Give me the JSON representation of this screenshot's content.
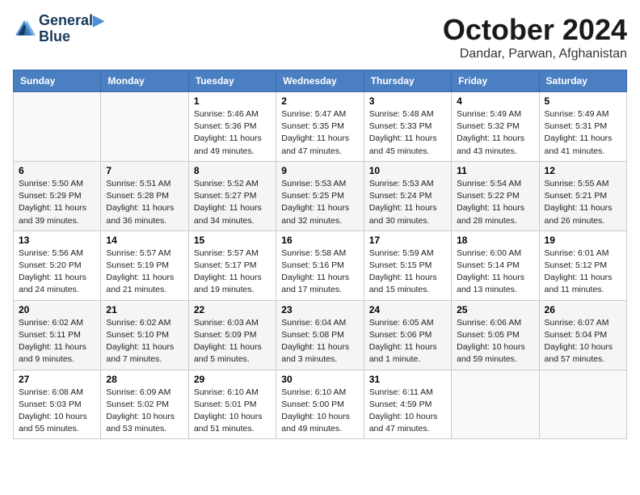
{
  "logo": {
    "line1": "General",
    "line2": "Blue"
  },
  "title": "October 2024",
  "location": "Dandar, Parwan, Afghanistan",
  "headers": [
    "Sunday",
    "Monday",
    "Tuesday",
    "Wednesday",
    "Thursday",
    "Friday",
    "Saturday"
  ],
  "weeks": [
    [
      {
        "day": "",
        "info": ""
      },
      {
        "day": "",
        "info": ""
      },
      {
        "day": "1",
        "info": "Sunrise: 5:46 AM\nSunset: 5:36 PM\nDaylight: 11 hours and 49 minutes."
      },
      {
        "day": "2",
        "info": "Sunrise: 5:47 AM\nSunset: 5:35 PM\nDaylight: 11 hours and 47 minutes."
      },
      {
        "day": "3",
        "info": "Sunrise: 5:48 AM\nSunset: 5:33 PM\nDaylight: 11 hours and 45 minutes."
      },
      {
        "day": "4",
        "info": "Sunrise: 5:49 AM\nSunset: 5:32 PM\nDaylight: 11 hours and 43 minutes."
      },
      {
        "day": "5",
        "info": "Sunrise: 5:49 AM\nSunset: 5:31 PM\nDaylight: 11 hours and 41 minutes."
      }
    ],
    [
      {
        "day": "6",
        "info": "Sunrise: 5:50 AM\nSunset: 5:29 PM\nDaylight: 11 hours and 39 minutes."
      },
      {
        "day": "7",
        "info": "Sunrise: 5:51 AM\nSunset: 5:28 PM\nDaylight: 11 hours and 36 minutes."
      },
      {
        "day": "8",
        "info": "Sunrise: 5:52 AM\nSunset: 5:27 PM\nDaylight: 11 hours and 34 minutes."
      },
      {
        "day": "9",
        "info": "Sunrise: 5:53 AM\nSunset: 5:25 PM\nDaylight: 11 hours and 32 minutes."
      },
      {
        "day": "10",
        "info": "Sunrise: 5:53 AM\nSunset: 5:24 PM\nDaylight: 11 hours and 30 minutes."
      },
      {
        "day": "11",
        "info": "Sunrise: 5:54 AM\nSunset: 5:22 PM\nDaylight: 11 hours and 28 minutes."
      },
      {
        "day": "12",
        "info": "Sunrise: 5:55 AM\nSunset: 5:21 PM\nDaylight: 11 hours and 26 minutes."
      }
    ],
    [
      {
        "day": "13",
        "info": "Sunrise: 5:56 AM\nSunset: 5:20 PM\nDaylight: 11 hours and 24 minutes."
      },
      {
        "day": "14",
        "info": "Sunrise: 5:57 AM\nSunset: 5:19 PM\nDaylight: 11 hours and 21 minutes."
      },
      {
        "day": "15",
        "info": "Sunrise: 5:57 AM\nSunset: 5:17 PM\nDaylight: 11 hours and 19 minutes."
      },
      {
        "day": "16",
        "info": "Sunrise: 5:58 AM\nSunset: 5:16 PM\nDaylight: 11 hours and 17 minutes."
      },
      {
        "day": "17",
        "info": "Sunrise: 5:59 AM\nSunset: 5:15 PM\nDaylight: 11 hours and 15 minutes."
      },
      {
        "day": "18",
        "info": "Sunrise: 6:00 AM\nSunset: 5:14 PM\nDaylight: 11 hours and 13 minutes."
      },
      {
        "day": "19",
        "info": "Sunrise: 6:01 AM\nSunset: 5:12 PM\nDaylight: 11 hours and 11 minutes."
      }
    ],
    [
      {
        "day": "20",
        "info": "Sunrise: 6:02 AM\nSunset: 5:11 PM\nDaylight: 11 hours and 9 minutes."
      },
      {
        "day": "21",
        "info": "Sunrise: 6:02 AM\nSunset: 5:10 PM\nDaylight: 11 hours and 7 minutes."
      },
      {
        "day": "22",
        "info": "Sunrise: 6:03 AM\nSunset: 5:09 PM\nDaylight: 11 hours and 5 minutes."
      },
      {
        "day": "23",
        "info": "Sunrise: 6:04 AM\nSunset: 5:08 PM\nDaylight: 11 hours and 3 minutes."
      },
      {
        "day": "24",
        "info": "Sunrise: 6:05 AM\nSunset: 5:06 PM\nDaylight: 11 hours and 1 minute."
      },
      {
        "day": "25",
        "info": "Sunrise: 6:06 AM\nSunset: 5:05 PM\nDaylight: 10 hours and 59 minutes."
      },
      {
        "day": "26",
        "info": "Sunrise: 6:07 AM\nSunset: 5:04 PM\nDaylight: 10 hours and 57 minutes."
      }
    ],
    [
      {
        "day": "27",
        "info": "Sunrise: 6:08 AM\nSunset: 5:03 PM\nDaylight: 10 hours and 55 minutes."
      },
      {
        "day": "28",
        "info": "Sunrise: 6:09 AM\nSunset: 5:02 PM\nDaylight: 10 hours and 53 minutes."
      },
      {
        "day": "29",
        "info": "Sunrise: 6:10 AM\nSunset: 5:01 PM\nDaylight: 10 hours and 51 minutes."
      },
      {
        "day": "30",
        "info": "Sunrise: 6:10 AM\nSunset: 5:00 PM\nDaylight: 10 hours and 49 minutes."
      },
      {
        "day": "31",
        "info": "Sunrise: 6:11 AM\nSunset: 4:59 PM\nDaylight: 10 hours and 47 minutes."
      },
      {
        "day": "",
        "info": ""
      },
      {
        "day": "",
        "info": ""
      }
    ]
  ]
}
